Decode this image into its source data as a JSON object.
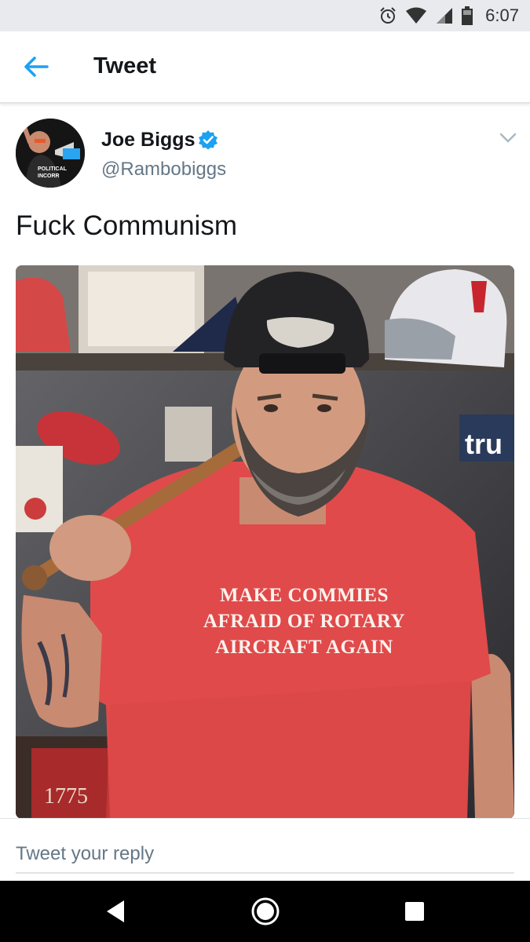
{
  "status_bar": {
    "time": "6:07",
    "icons": [
      "alarm-icon",
      "wifi-icon",
      "signal-icon",
      "battery-icon"
    ]
  },
  "header": {
    "title": "Tweet",
    "back_icon": "arrow-left-icon",
    "accent_color": "#1da1f2"
  },
  "tweet": {
    "author_name": "Joe Biggs",
    "author_handle": "@Rambobiggs",
    "verified": true,
    "text": "Fuck Communism",
    "photo": {
      "shirt_lines": [
        "MAKE COMMIES",
        "AFRAID OF ROTARY",
        "AIRCRAFT AGAIN"
      ],
      "shirt_color": "#e04a4a"
    }
  },
  "reply": {
    "placeholder": "Tweet your reply"
  },
  "nav": {
    "buttons": [
      "back-triangle-icon",
      "home-circle-icon",
      "recents-square-icon"
    ]
  }
}
